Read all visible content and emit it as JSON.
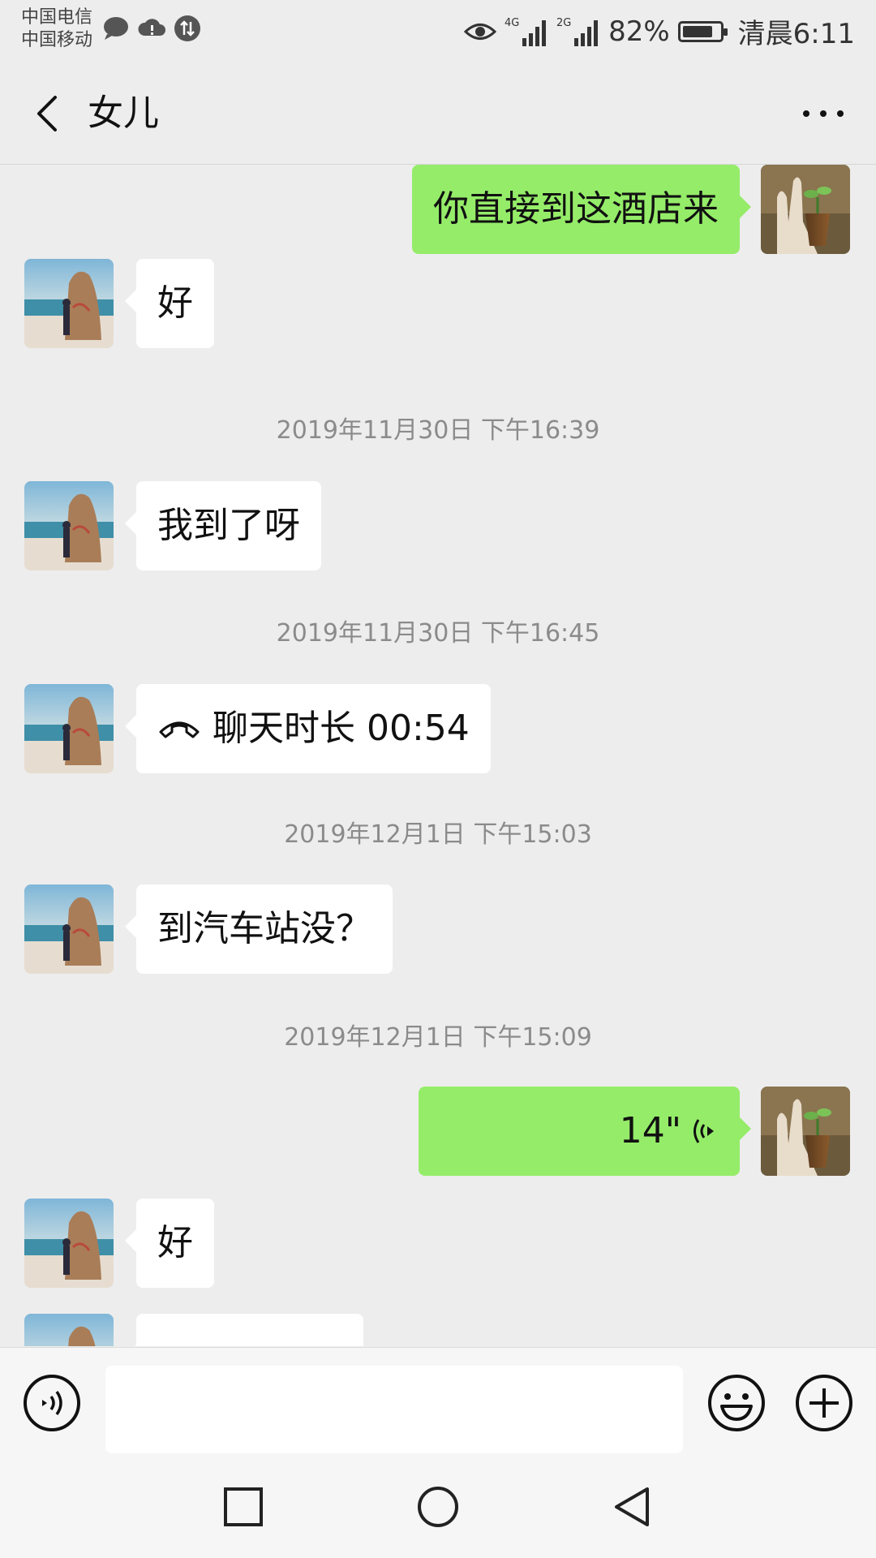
{
  "status_bar": {
    "carrier_1": "中国电信",
    "carrier_2": "中国移动",
    "net_4g": "4G",
    "net_2g": "2G",
    "battery_percent": "82%",
    "battery_level": 0.82,
    "time": "清晨6:11",
    "icons": [
      "chat-bubble-icon",
      "cloud-alert-icon",
      "data-sync-icon",
      "eye-icon",
      "signal-4g-icon",
      "signal-2g-icon",
      "battery-icon"
    ]
  },
  "header": {
    "title": "女儿",
    "back_icon": "chevron-left-icon",
    "more_icon": "more-dots-icon"
  },
  "messages": [
    {
      "type": "text",
      "dir": "out",
      "text": "你直接到这酒店来"
    },
    {
      "type": "text",
      "dir": "in",
      "text": "好"
    },
    {
      "type": "time",
      "text": "2019年11月30日 下午16:39"
    },
    {
      "type": "text",
      "dir": "in",
      "text": "我到了呀"
    },
    {
      "type": "time",
      "text": "2019年11月30日 下午16:45"
    },
    {
      "type": "call",
      "dir": "in",
      "text": "聊天时长 00:54",
      "icon": "phone-hangup-icon"
    },
    {
      "type": "time",
      "text": "2019年12月1日 下午15:03"
    },
    {
      "type": "text",
      "dir": "in",
      "text": "到汽车站没？"
    },
    {
      "type": "time",
      "text": "2019年12月1日 下午15:09"
    },
    {
      "type": "voice",
      "dir": "out",
      "text": "14\"",
      "icon": "voice-wave-icon"
    },
    {
      "type": "text",
      "dir": "in",
      "text": "好"
    }
  ],
  "input_bar": {
    "voice_icon": "voice-input-icon",
    "emoji_icon": "emoji-icon",
    "plus_icon": "plus-icon",
    "text_value": ""
  },
  "nav_bar": {
    "icons": [
      "recent-apps-icon",
      "home-icon",
      "back-triangle-icon"
    ]
  },
  "colors": {
    "background": "#ededed",
    "outgoing_bubble": "#95ec69",
    "incoming_bubble": "#ffffff",
    "timestamp": "#8b8b8b"
  }
}
